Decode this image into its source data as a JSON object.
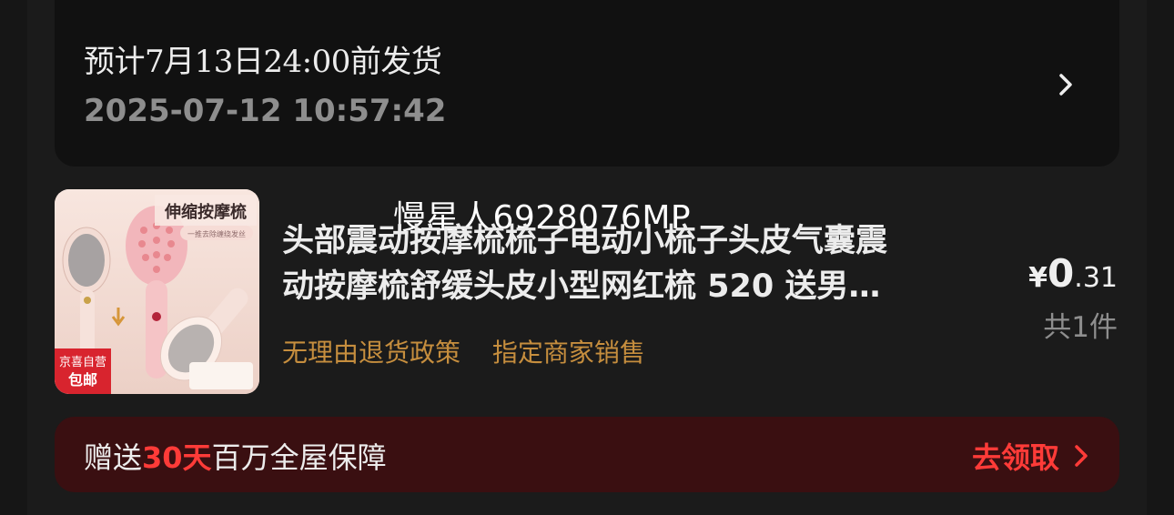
{
  "shipping": {
    "estimate": "预计7月13日24:00前发货",
    "timestamp": "2025-07-12 10:57:42",
    "chevron_icon": "chevron-right-icon"
  },
  "watermark": "慢星人6928076MP",
  "product": {
    "thumbnail": {
      "banner_text": "伸缩按摩梳",
      "sub_text": "一推去除缠绕发丝",
      "badge_top": "京喜自营",
      "badge_bottom": "包邮"
    },
    "title_line1": "头部震动按摩梳梳子电动小梳子头皮气囊震",
    "title_line2": "动按摩梳舒缓头皮小型网红梳 520 送男…",
    "tags": [
      "无理由退货政策",
      "指定商家销售"
    ],
    "price": {
      "currency": "¥",
      "integer": "0",
      "decimal": ".31"
    },
    "quantity": "共1件"
  },
  "banner": {
    "text_prefix": "赠送",
    "highlight": "30天",
    "text_suffix": "百万全屋保障",
    "cta": "去领取"
  },
  "colors": {
    "page_bg": "#161616",
    "card_bg": "#111111",
    "accent_red": "#ff3b38",
    "tag_gold": "#c68e3e",
    "banner_bg": "#3a0f11"
  }
}
